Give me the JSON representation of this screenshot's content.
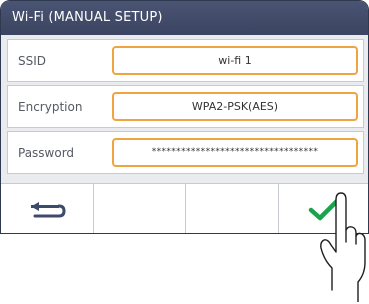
{
  "header": {
    "title": "Wi-Fi (MANUAL SETUP)"
  },
  "fields": [
    {
      "label": "SSID",
      "value": "wi-fi 1"
    },
    {
      "label": "Encryption",
      "value": "WPA2-PSK(AES)"
    },
    {
      "label": "Password",
      "value": "**********************************"
    }
  ],
  "toolbar": {
    "back_icon": "back-arrow-icon",
    "confirm_icon": "checkmark-icon",
    "confirm_color": "#1aa34a"
  },
  "colors": {
    "title_bar": "#3b4461",
    "field_border": "#f0a441",
    "background": "#e9ebef"
  }
}
